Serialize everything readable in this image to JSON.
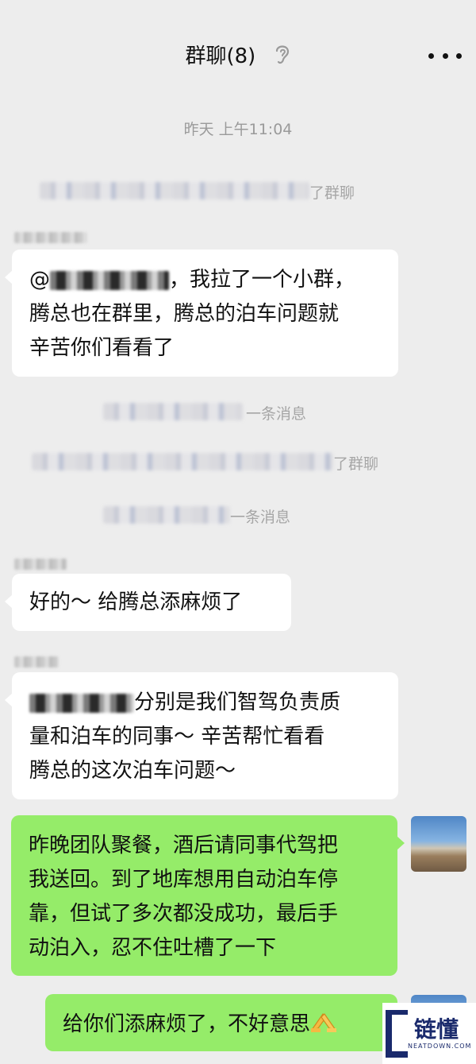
{
  "header": {
    "title": "群聊(8)",
    "ear_icon": "ear-icon",
    "more_icon": "more-icon"
  },
  "timestamp": "昨天 上午11:04",
  "system_messages": [
    {
      "visible_text": "了群聊"
    },
    {
      "visible_text": "一条消息"
    },
    {
      "visible_text": "了群聊"
    },
    {
      "visible_text": "一条消息"
    }
  ],
  "messages": [
    {
      "side": "left",
      "lines": [
        "，我拉了一个小群，",
        "腾总也在群里，腾总的泊车问题就",
        "辛苦你们看看了"
      ],
      "prefix": "@"
    },
    {
      "side": "left",
      "lines": [
        "好的～ 给腾总添麻烦了"
      ]
    },
    {
      "side": "left",
      "lines": [
        "分别是我们智驾负责质",
        "量和泊车的同事～ 辛苦帮忙看看",
        "腾总的这次泊车问题～"
      ]
    },
    {
      "side": "right",
      "lines": [
        "昨晚团队聚餐，酒后请同事代驾把",
        "我送回。到了地库想用自动泊车停",
        "靠，但试了多次都没成功，最后手",
        "动泊入，忍不住吐槽了一下"
      ]
    },
    {
      "side": "right",
      "lines": [
        "给你们添麻烦了，不好意思"
      ],
      "emoji": "folded-hands-icon"
    }
  ],
  "watermark": {
    "text": "链懂",
    "sub": "NEATDOWN.COM"
  },
  "colors": {
    "background": "#ededed",
    "left_bubble": "#ffffff",
    "right_bubble": "#95ec69",
    "system_text": "#a6a6a6"
  }
}
